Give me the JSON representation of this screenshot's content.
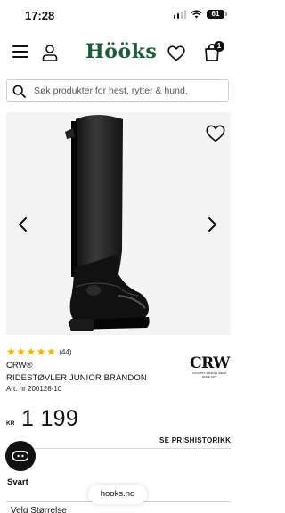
{
  "status_bar": {
    "time": "17:28",
    "battery": "61"
  },
  "header": {
    "logo": "Hööks",
    "cart_count": "1"
  },
  "search": {
    "placeholder": "Søk produkter for hest, rytter & hund."
  },
  "product": {
    "review_count": "(44)",
    "brand": "CRW®",
    "name": "RIDESTØVLER JUNIOR BRANDON",
    "article": "Art. nr 200128-10",
    "brand_logo": "CRW",
    "brand_logo_sub": "COUNTRY & RIDING WEAR SINCE 1978",
    "currency": "KR",
    "price": "1 199",
    "price_history_link": "SE PRISHISTORIKK",
    "color_label": "Svart",
    "select_label": "Velg Størrelse"
  },
  "browser": {
    "url": "hooks.no"
  },
  "rating": {
    "stars": 5,
    "max": 5
  },
  "colors": {
    "brand_green": "#1f5c3a",
    "star": "#f5b301"
  },
  "icons": [
    "signal-icon",
    "wifi-icon",
    "battery-icon",
    "menu-icon",
    "account-icon",
    "heart-icon",
    "bag-icon",
    "search-icon",
    "chevron-left-icon",
    "chevron-right-icon",
    "chat-icon"
  ]
}
